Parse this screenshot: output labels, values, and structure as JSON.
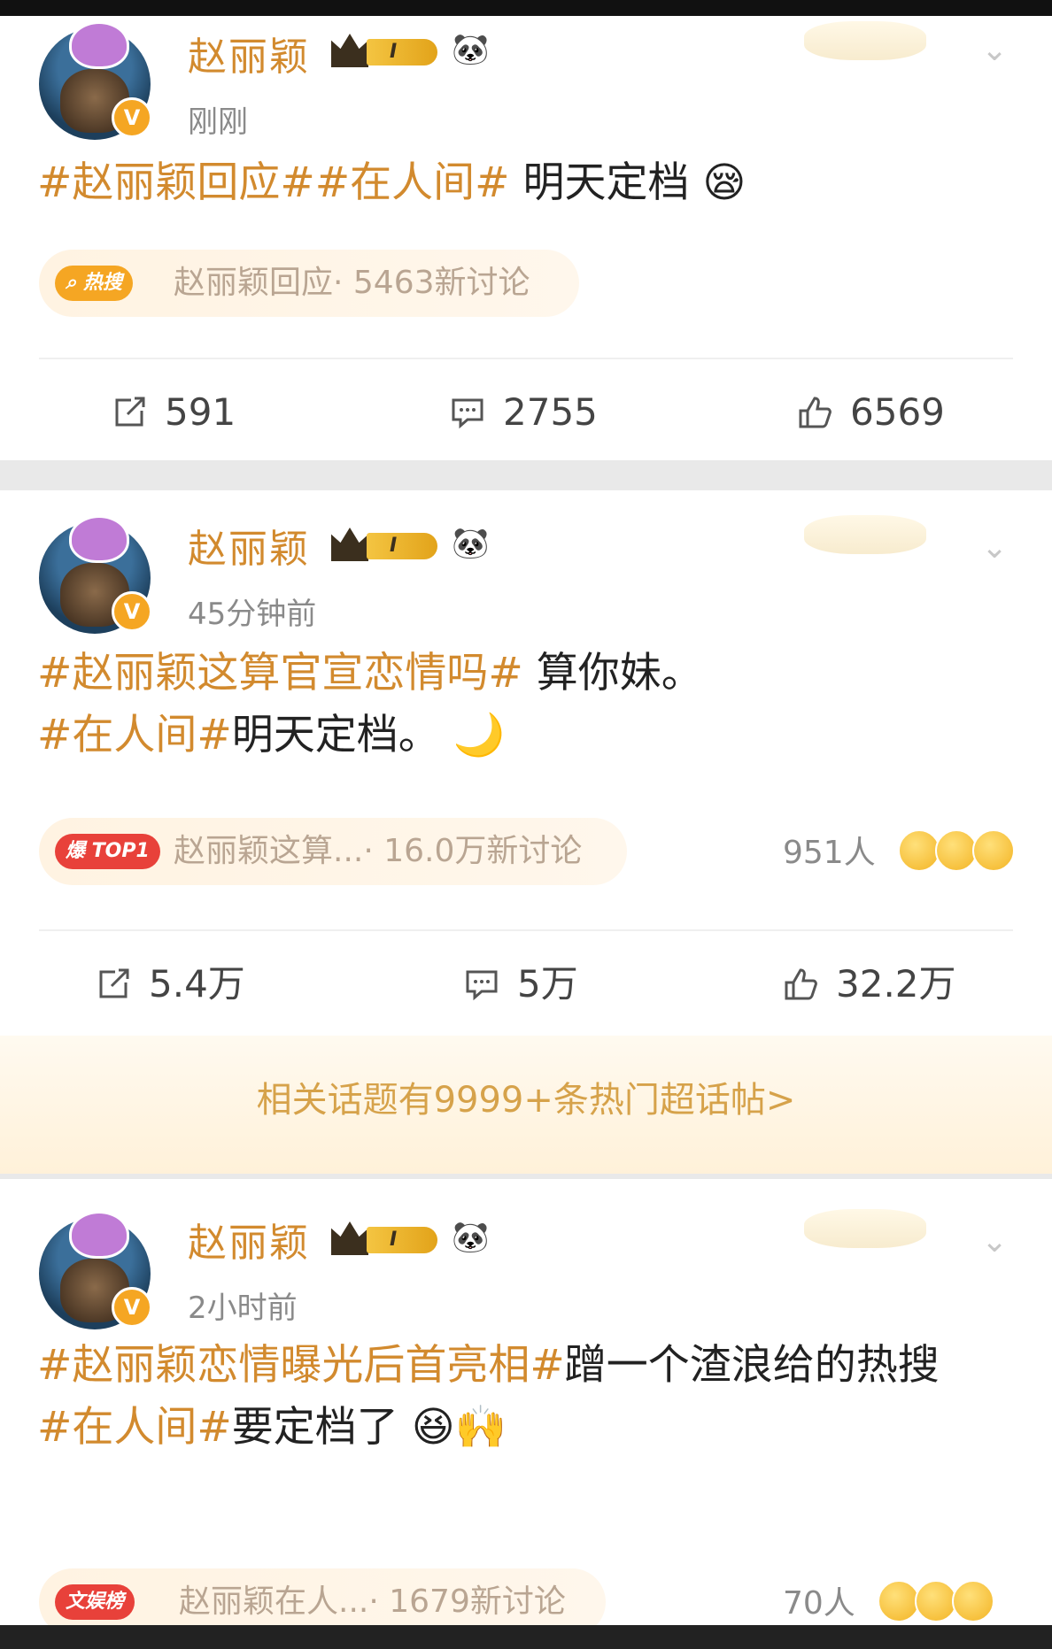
{
  "posts": [
    {
      "author": "赵丽颖",
      "level": "I",
      "time": "刚刚",
      "lines": [
        {
          "tag": "#赵丽颖回应#",
          "tag2": "#在人间#",
          "text": " 明天定档"
        }
      ],
      "hot": {
        "pill": "热搜",
        "topic": "赵丽颖回应",
        "discussions": "· 5463新讨论"
      },
      "stats": {
        "repost": "591",
        "comment": "2755",
        "like": "6569"
      }
    },
    {
      "author": "赵丽颖",
      "level": "I",
      "time": "45分钟前",
      "lines": [
        {
          "tag": "#赵丽颖这算官宣恋情吗#",
          "text": " 算你妹。"
        },
        {
          "tag": "#在人间#",
          "text": "明天定档。"
        }
      ],
      "hot": {
        "pill": "爆 TOP1",
        "topic": "赵丽颖这算...",
        "discussions": "· 16.0万新讨论"
      },
      "reactions": "951人",
      "stats": {
        "repost": "5.4万",
        "comment": "5万",
        "like": "32.2万"
      }
    },
    {
      "author": "赵丽颖",
      "level": "I",
      "time": "2小时前",
      "lines": [
        {
          "tag": "#赵丽颖恋情曝光后首亮相#",
          "text": "蹭一个渣浪给的热搜"
        },
        {
          "tag": "#在人间#",
          "text": "要定档了"
        }
      ],
      "hot": {
        "pill": "文娱榜",
        "topic": "赵丽颖在人...",
        "discussions": "· 1679新讨论"
      },
      "reactions": "70人"
    }
  ],
  "banner": "相关话题有9999+条热门超话帖>",
  "colors": {
    "accent": "#d28a2e",
    "hot_orange": "#f5a623",
    "hot_red": "#e8413a"
  }
}
